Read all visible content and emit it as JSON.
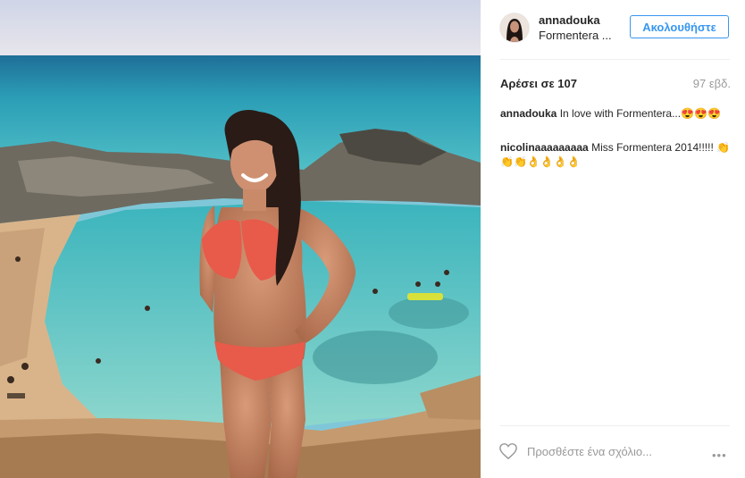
{
  "post": {
    "username": "annadouka",
    "location": "Formentera ...",
    "follow_label": "Ακολουθήστε",
    "likes": "Αρέσει σε 107",
    "age": "97 εβδ."
  },
  "comments": [
    {
      "user": "annadouka",
      "text": "In love with Formentera...😍😍😍"
    },
    {
      "user": "nicolinaaaaaaaaa",
      "text": "Miss Formentera 2014!!!!! 👏👏👏👌👌👌👌"
    }
  ],
  "actions": {
    "comment_placeholder": "Προσθέστε ένα σχόλιο...",
    "more": "•••"
  },
  "colors": {
    "accent": "#3897f0",
    "muted": "#999999"
  }
}
